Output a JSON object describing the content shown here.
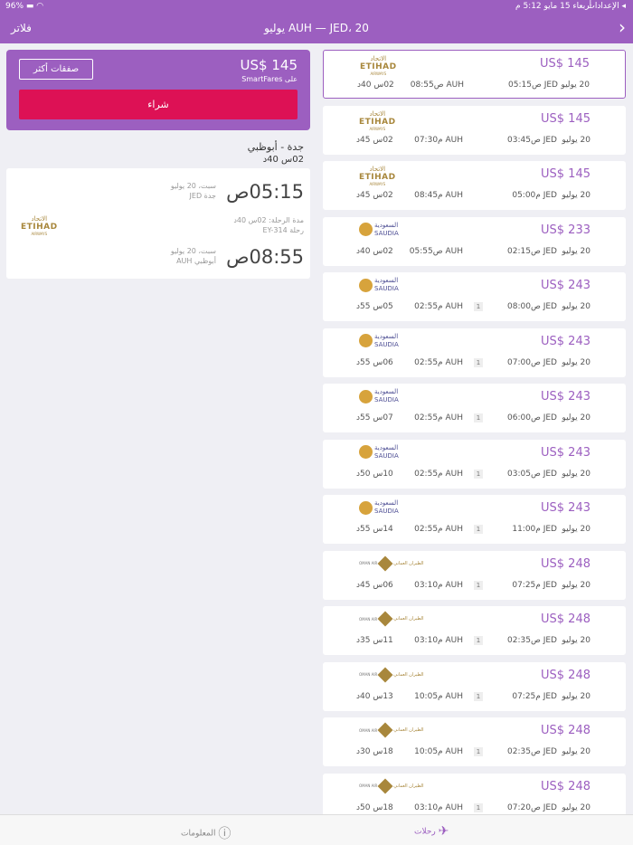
{
  "status": {
    "battery": "96%",
    "time": "5:12 م",
    "date": "أربعاء 15 مايو",
    "settings": "الإعدادات"
  },
  "nav": {
    "title": "AUH — JED، 20 يوليو",
    "filters": "فلاتر",
    "back_icon": "chevron-right-icon"
  },
  "selected": {
    "price": "US$ 145",
    "on": "على SmartFares",
    "more_deals": "صفقات أكثر",
    "buy": "شراء",
    "route": "جدة - أبوظبي",
    "duration": "02س 40د",
    "dep_time": "05:15ص",
    "dep_date": "سبت، 20 يوليو",
    "dep_city": "جدة JED",
    "flight_duration": "مدة الرحلة: 02س 40د",
    "flight_no": "رحلة EY-314",
    "arr_time": "08:55ص",
    "arr_date": "سبت، 20 يوليو",
    "arr_city": "أبوظبي AUH"
  },
  "flights": [
    {
      "price": "US$ 145",
      "airline": "etihad",
      "date": "20 يوليو",
      "dep": "05:15ص JED",
      "stops": "",
      "arr": "08:55ص AUH",
      "dur": "02س 40د",
      "selected": true
    },
    {
      "price": "US$ 145",
      "airline": "etihad",
      "date": "20 يوليو",
      "dep": "03:45ص JED",
      "stops": "",
      "arr": "07:30م AUH",
      "dur": "02س 45د"
    },
    {
      "price": "US$ 145",
      "airline": "etihad",
      "date": "20 يوليو",
      "dep": "05:00م JED",
      "stops": "",
      "arr": "08:45م AUH",
      "dur": "02س 45د"
    },
    {
      "price": "US$ 233",
      "airline": "saudia",
      "date": "20 يوليو",
      "dep": "02:15ص JED",
      "stops": "",
      "arr": "05:55ص AUH",
      "dur": "02س 40د"
    },
    {
      "price": "US$ 243",
      "airline": "saudia",
      "date": "20 يوليو",
      "dep": "08:00ص JED",
      "stops": "1",
      "arr": "02:55م AUH",
      "dur": "05س 55د"
    },
    {
      "price": "US$ 243",
      "airline": "saudia",
      "date": "20 يوليو",
      "dep": "07:00ص JED",
      "stops": "1",
      "arr": "02:55م AUH",
      "dur": "06س 55د"
    },
    {
      "price": "US$ 243",
      "airline": "saudia",
      "date": "20 يوليو",
      "dep": "06:00ص JED",
      "stops": "1",
      "arr": "02:55م AUH",
      "dur": "07س 55د"
    },
    {
      "price": "US$ 243",
      "airline": "saudia",
      "date": "20 يوليو",
      "dep": "03:05ص JED",
      "stops": "1",
      "arr": "02:55م AUH",
      "dur": "10س 50د"
    },
    {
      "price": "US$ 243",
      "airline": "saudia",
      "date": "20 يوليو",
      "dep": "11:00م JED",
      "stops": "1",
      "arr": "02:55م AUH",
      "dur": "14س 55د"
    },
    {
      "price": "US$ 248",
      "airline": "oman",
      "date": "20 يوليو",
      "dep": "07:25م JED",
      "stops": "1",
      "arr": "03:10م AUH",
      "dur": "06س 45د"
    },
    {
      "price": "US$ 248",
      "airline": "oman",
      "date": "20 يوليو",
      "dep": "02:35ص JED",
      "stops": "1",
      "arr": "03:10م AUH",
      "dur": "11س 35د"
    },
    {
      "price": "US$ 248",
      "airline": "oman",
      "date": "20 يوليو",
      "dep": "07:25م JED",
      "stops": "1",
      "arr": "10:05م AUH",
      "dur": "13س 40د"
    },
    {
      "price": "US$ 248",
      "airline": "oman",
      "date": "20 يوليو",
      "dep": "02:35ص JED",
      "stops": "1",
      "arr": "10:05م AUH",
      "dur": "18س 30د"
    },
    {
      "price": "US$ 248",
      "airline": "oman",
      "date": "20 يوليو",
      "dep": "07:20ص JED",
      "stops": "1",
      "arr": "03:10م AUH",
      "dur": "18س 50د"
    }
  ],
  "airlines": {
    "etihad": {
      "ar": "الاتحاد",
      "en": "ETIHAD",
      "sub": "AIRWAYS"
    },
    "saudia": {
      "ar": "السعودية",
      "en": "SAUDIA"
    },
    "oman": {
      "ar": "الطيران العماني",
      "en": "OMAN AIR"
    }
  },
  "tabs": {
    "flights": "رحلات",
    "info": "المعلومات"
  },
  "colors": {
    "brand": "#9c5fc0",
    "buy": "#dd1155"
  }
}
